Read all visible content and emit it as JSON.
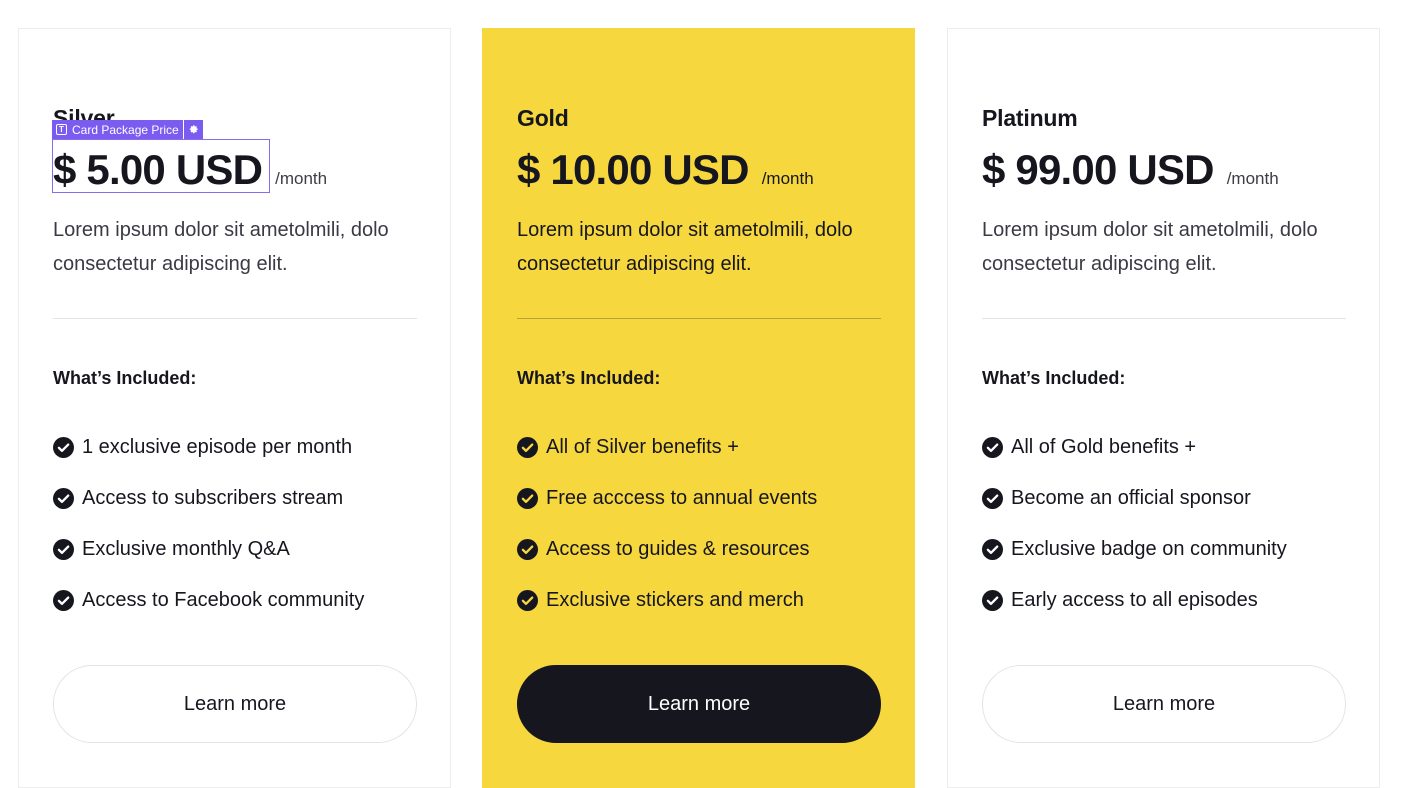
{
  "plans": [
    {
      "name": "Silver",
      "price": "$ 5.00 USD",
      "period": "/month",
      "description": "Lorem ipsum dolor sit ametolmili, dolo consectetur adipiscing elit.",
      "included_title": "What’s Included:",
      "features": [
        "1 exclusive episode per month",
        "Access to subscribers stream",
        "Exclusive monthly Q&A",
        "Access to Facebook community"
      ],
      "button_label": "Learn more"
    },
    {
      "name": "Gold",
      "price": "$ 10.00 USD",
      "period": "/month",
      "description": "Lorem ipsum dolor sit ametolmili, dolo consectetur adipiscing elit.",
      "included_title": "What’s Included:",
      "features": [
        "All of Silver benefits +",
        "Free acccess to annual events",
        "Access to guides & resources",
        "Exclusive stickers and merch"
      ],
      "button_label": "Learn more"
    },
    {
      "name": "Platinum",
      "price": "$ 99.00 USD",
      "period": "/month",
      "description": "Lorem ipsum dolor sit ametolmili, dolo consectetur adipiscing elit.",
      "included_title": "What’s Included:",
      "features": [
        "All of Gold benefits +",
        "Become an official sponsor",
        "Exclusive badge on community",
        "Early access to all episodes"
      ],
      "button_label": "Learn more"
    }
  ],
  "editor_overlay": {
    "label": "Card Package Price",
    "icon": "text-element-icon",
    "settings_icon": "gear-icon"
  },
  "colors": {
    "featured_background": "#f6d73d",
    "dark": "#16161f",
    "selection": "#7b5cf0"
  }
}
